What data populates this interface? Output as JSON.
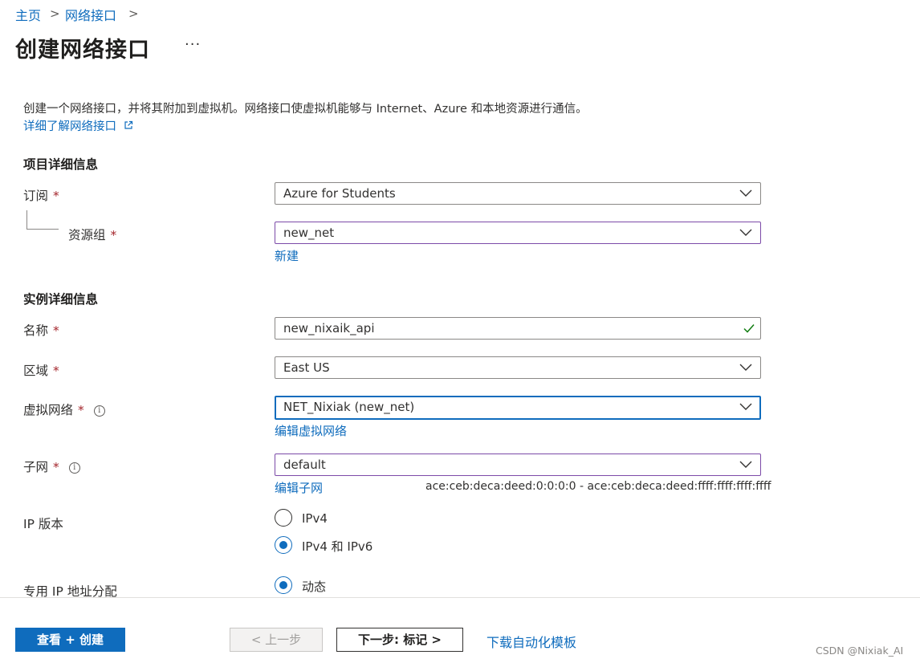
{
  "breadcrumb": {
    "home": "主页",
    "separator": ">",
    "current": "网络接口",
    "trailing": ">"
  },
  "page": {
    "title": "创建网络接口",
    "more_label": "···"
  },
  "intro": {
    "description": "创建一个网络接口，并将其附加到虚拟机。网络接口使虚拟机能够与 Internet、Azure 和本地资源进行通信。",
    "learn_more": "详细了解网络接口",
    "learn_more_icon": "external-link-icon"
  },
  "project": {
    "heading": "项目详细信息",
    "subscription": {
      "label": "订阅",
      "required": "*",
      "value": "Azure for Students"
    },
    "resource_group": {
      "label": "资源组",
      "required": "*",
      "value": "new_net",
      "create_new": "新建"
    }
  },
  "instance": {
    "heading": "实例详细信息",
    "name": {
      "label": "名称",
      "required": "*",
      "value": "new_nixaik_api",
      "valid_icon": "checkmark-icon"
    },
    "region": {
      "label": "区域",
      "required": "*",
      "value": "East US"
    },
    "vnet": {
      "label": "虚拟网络",
      "required": "*",
      "info": "i",
      "value": "NET_Nixiak (new_net)",
      "edit": "编辑虚拟网络"
    },
    "subnet": {
      "label": "子网",
      "required": "*",
      "info": "i",
      "value": "default",
      "edit": "编辑子网",
      "range": "ace:ceb:deca:deed:0:0:0:0 - ace:ceb:deca:deed:ffff:ffff:ffff:ffff"
    },
    "ip_version": {
      "label": "IP 版本",
      "options": [
        "IPv4",
        "IPv4 和 IPv6"
      ],
      "selected": "IPv4 和 IPv6"
    },
    "private_ip": {
      "label": "专用 IP 地址分配",
      "options": [
        "动态"
      ],
      "selected": "动态"
    }
  },
  "footer": {
    "review_create": "查看 + 创建",
    "previous": "< 上一步",
    "next": "下一步: 标记 >",
    "download_template": "下载自动化模板"
  },
  "watermark": "CSDN @Nixiak_AI",
  "colors": {
    "accent": "#0f6cbd",
    "required": "#a4262c",
    "valid": "#107c10",
    "purple_border": "#7c4aa8"
  }
}
